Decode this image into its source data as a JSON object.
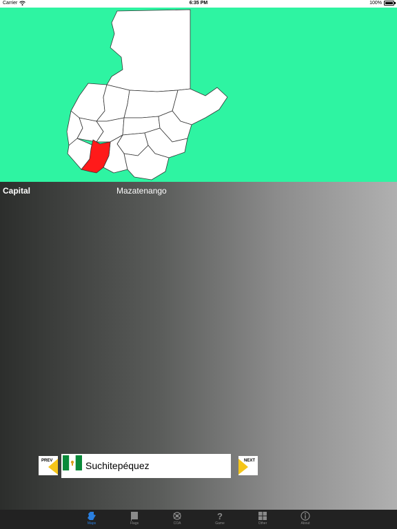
{
  "status_bar": {
    "carrier": "Carrier",
    "time": "6:35 PM",
    "battery": "100%",
    "battery_level": 1.0
  },
  "map": {
    "background_color": "#2ef4a2",
    "highlight_color": "#ff1a1a"
  },
  "info": {
    "label": "Capital",
    "value": "Mazatenango"
  },
  "navigation": {
    "prev_label": "PREV",
    "next_label": "NEXT",
    "arrow_color": "#f5c518",
    "department_name": "Suchitepéquez",
    "flag_colors": [
      "#0a8a3a",
      "#ffffff",
      "#0a8a3a"
    ]
  },
  "tab_bar": {
    "items": [
      {
        "label": "Maps",
        "icon": "map-icon",
        "active": true
      },
      {
        "label": "Flags",
        "icon": "flag-icon"
      },
      {
        "label": "COA",
        "icon": "coat-of-arms-icon"
      },
      {
        "label": "Game",
        "icon": "question-icon"
      },
      {
        "label": "Other",
        "icon": "grid-icon"
      },
      {
        "label": "About",
        "icon": "info-icon"
      }
    ],
    "active_color": "#2a7fe0",
    "inactive_color": "#8a8a8a"
  }
}
